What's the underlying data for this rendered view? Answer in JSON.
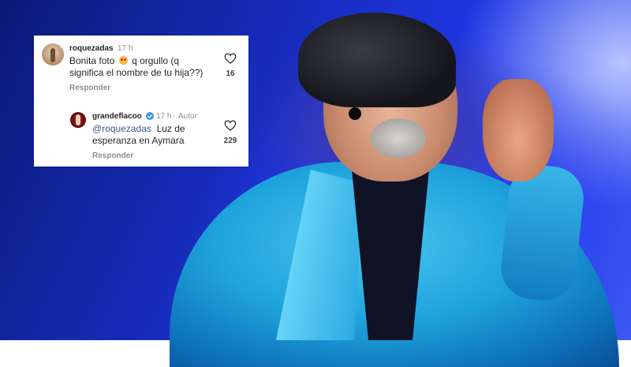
{
  "comments": [
    {
      "username": "roquezadas",
      "time": "17 h",
      "text_before_emoji": "Bonita foto",
      "emoji": "heart-eyes-emoji",
      "text_after_emoji": "q orgullo (q",
      "text_line2": "significa el nombre de tu hija??)",
      "likes": "16",
      "reply_label": "Responder"
    },
    {
      "username": "grandeflacoo",
      "time": "17 h",
      "separator": "·",
      "author_badge": "Autor",
      "mention": "@roquezadas",
      "text_line1": "Luz de",
      "text_line2": "esperanza en Aymara",
      "likes": "229",
      "reply_label": "Responder"
    }
  ],
  "colors": {
    "background_blue": "#1e36e6",
    "jacket_turquoise": "#1fa3dc",
    "card_white": "#ffffff",
    "verified_blue": "#3897f0",
    "mention_blue": "#385898"
  }
}
